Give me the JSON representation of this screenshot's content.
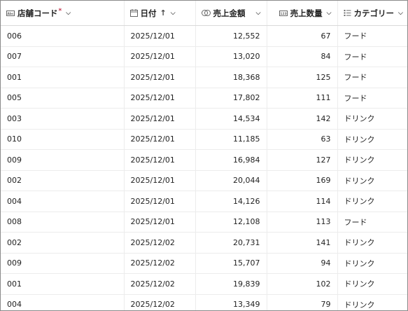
{
  "columns": {
    "store_code": {
      "label": "店舗コード",
      "required_mark": "*",
      "icon": "text-field-icon"
    },
    "date": {
      "label": "日付",
      "sort_indicator": "↑",
      "icon": "calendar-icon"
    },
    "sales_amount": {
      "label": "売上金額",
      "icon": "currency-icon"
    },
    "sales_qty": {
      "label": "売上数量",
      "icon": "number-icon"
    },
    "category": {
      "label": "カテゴリー",
      "icon": "choice-list-icon"
    }
  },
  "rows": [
    {
      "store_code": "006",
      "date": "2025/12/01",
      "sales_amount": "12,552",
      "sales_qty": "67",
      "category": "フード"
    },
    {
      "store_code": "007",
      "date": "2025/12/01",
      "sales_amount": "13,020",
      "sales_qty": "84",
      "category": "フード"
    },
    {
      "store_code": "001",
      "date": "2025/12/01",
      "sales_amount": "18,368",
      "sales_qty": "125",
      "category": "フード"
    },
    {
      "store_code": "005",
      "date": "2025/12/01",
      "sales_amount": "17,802",
      "sales_qty": "111",
      "category": "フード"
    },
    {
      "store_code": "003",
      "date": "2025/12/01",
      "sales_amount": "14,534",
      "sales_qty": "142",
      "category": "ドリンク"
    },
    {
      "store_code": "010",
      "date": "2025/12/01",
      "sales_amount": "11,185",
      "sales_qty": "63",
      "category": "ドリンク"
    },
    {
      "store_code": "009",
      "date": "2025/12/01",
      "sales_amount": "16,984",
      "sales_qty": "127",
      "category": "ドリンク"
    },
    {
      "store_code": "002",
      "date": "2025/12/01",
      "sales_amount": "20,044",
      "sales_qty": "169",
      "category": "ドリンク"
    },
    {
      "store_code": "004",
      "date": "2025/12/01",
      "sales_amount": "14,126",
      "sales_qty": "114",
      "category": "ドリンク"
    },
    {
      "store_code": "008",
      "date": "2025/12/01",
      "sales_amount": "12,108",
      "sales_qty": "113",
      "category": "フード"
    },
    {
      "store_code": "002",
      "date": "2025/12/02",
      "sales_amount": "20,731",
      "sales_qty": "141",
      "category": "ドリンク"
    },
    {
      "store_code": "009",
      "date": "2025/12/02",
      "sales_amount": "15,707",
      "sales_qty": "94",
      "category": "ドリンク"
    },
    {
      "store_code": "001",
      "date": "2025/12/02",
      "sales_amount": "19,839",
      "sales_qty": "102",
      "category": "ドリンク"
    },
    {
      "store_code": "004",
      "date": "2025/12/02",
      "sales_amount": "13,349",
      "sales_qty": "79",
      "category": "ドリンク"
    }
  ],
  "colors": {
    "required": "#c4314b",
    "grid_line": "#ececec",
    "frame": "#8a8a8a"
  }
}
